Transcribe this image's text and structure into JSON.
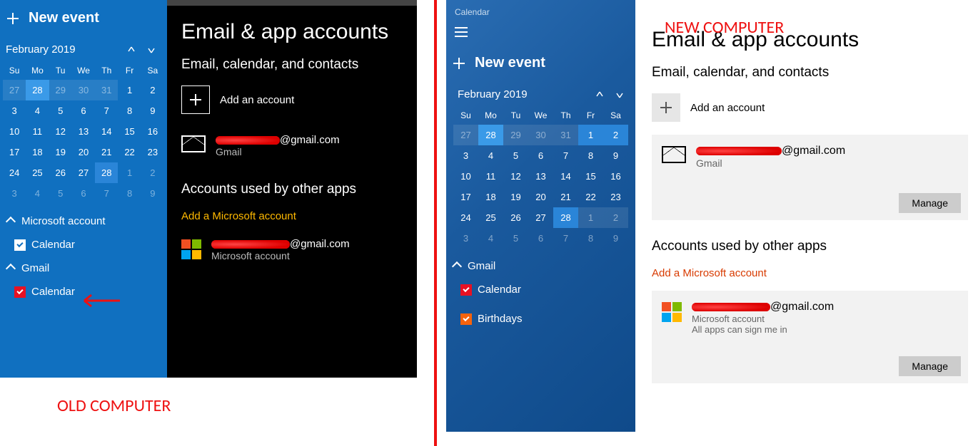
{
  "old": {
    "calendar": {
      "new_event": "New event",
      "month": "February 2019",
      "dow": [
        "Su",
        "Mo",
        "Tu",
        "We",
        "Th",
        "Fr",
        "Sa"
      ],
      "rows": [
        [
          {
            "d": "27",
            "dim": 1,
            "shade": 1
          },
          {
            "d": "28",
            "sel": 1
          },
          {
            "d": "29",
            "dim": 1,
            "shade": 1
          },
          {
            "d": "30",
            "dim": 1,
            "shade": 1
          },
          {
            "d": "31",
            "dim": 1,
            "shade": 1
          },
          {
            "d": "1"
          },
          {
            "d": "2"
          }
        ],
        [
          {
            "d": "3"
          },
          {
            "d": "4"
          },
          {
            "d": "5"
          },
          {
            "d": "6"
          },
          {
            "d": "7"
          },
          {
            "d": "8"
          },
          {
            "d": "9"
          }
        ],
        [
          {
            "d": "10"
          },
          {
            "d": "11"
          },
          {
            "d": "12"
          },
          {
            "d": "13"
          },
          {
            "d": "14"
          },
          {
            "d": "15"
          },
          {
            "d": "16"
          }
        ],
        [
          {
            "d": "17"
          },
          {
            "d": "18"
          },
          {
            "d": "19"
          },
          {
            "d": "20"
          },
          {
            "d": "21"
          },
          {
            "d": "22"
          },
          {
            "d": "23"
          }
        ],
        [
          {
            "d": "24"
          },
          {
            "d": "25"
          },
          {
            "d": "26"
          },
          {
            "d": "27"
          },
          {
            "d": "28",
            "bright": 1
          },
          {
            "d": "1",
            "dim": 1
          },
          {
            "d": "2",
            "dim": 1
          }
        ],
        [
          {
            "d": "3",
            "dim": 1
          },
          {
            "d": "4",
            "dim": 1
          },
          {
            "d": "5",
            "dim": 1
          },
          {
            "d": "6",
            "dim": 1
          },
          {
            "d": "7",
            "dim": 1
          },
          {
            "d": "8",
            "dim": 1
          },
          {
            "d": "9",
            "dim": 1
          }
        ]
      ],
      "acct1": "Microsoft account",
      "acct1_item": "Calendar",
      "acct2": "Gmail",
      "acct2_item": "Calendar"
    },
    "settings": {
      "h1": "Email & app accounts",
      "h2a": "Email, calendar, and contacts",
      "add": "Add an account",
      "email_suffix": "@gmail.com",
      "gmail": "Gmail",
      "h2b": "Accounts used by other apps",
      "addms": "Add a Microsoft account",
      "msacct": "Microsoft account"
    },
    "label": "OLD COMPUTER"
  },
  "new": {
    "calendar": {
      "title": "Calendar",
      "new_event": "New event",
      "month": "February 2019",
      "dow": [
        "Su",
        "Mo",
        "Tu",
        "We",
        "Th",
        "Fr",
        "Sa"
      ],
      "rows": [
        [
          {
            "d": "27",
            "dim": 1,
            "shade": 1
          },
          {
            "d": "28",
            "sel": 1
          },
          {
            "d": "29",
            "dim": 1,
            "shade": 1
          },
          {
            "d": "30",
            "dim": 1,
            "shade": 1
          },
          {
            "d": "31",
            "dim": 1,
            "shade": 1
          },
          {
            "d": "1",
            "bright": 1
          },
          {
            "d": "2",
            "bright": 1
          }
        ],
        [
          {
            "d": "3"
          },
          {
            "d": "4"
          },
          {
            "d": "5"
          },
          {
            "d": "6"
          },
          {
            "d": "7"
          },
          {
            "d": "8"
          },
          {
            "d": "9"
          }
        ],
        [
          {
            "d": "10"
          },
          {
            "d": "11"
          },
          {
            "d": "12"
          },
          {
            "d": "13"
          },
          {
            "d": "14"
          },
          {
            "d": "15"
          },
          {
            "d": "16"
          }
        ],
        [
          {
            "d": "17"
          },
          {
            "d": "18"
          },
          {
            "d": "19"
          },
          {
            "d": "20"
          },
          {
            "d": "21"
          },
          {
            "d": "22"
          },
          {
            "d": "23"
          }
        ],
        [
          {
            "d": "24"
          },
          {
            "d": "25"
          },
          {
            "d": "26"
          },
          {
            "d": "27"
          },
          {
            "d": "28",
            "bright": 1
          },
          {
            "d": "1",
            "dim": 1,
            "shade": 1
          },
          {
            "d": "2",
            "dim": 1,
            "shade": 1
          }
        ],
        [
          {
            "d": "3",
            "dim": 1
          },
          {
            "d": "4",
            "dim": 1
          },
          {
            "d": "5",
            "dim": 1
          },
          {
            "d": "6",
            "dim": 1
          },
          {
            "d": "7",
            "dim": 1
          },
          {
            "d": "8",
            "dim": 1
          },
          {
            "d": "9",
            "dim": 1
          }
        ]
      ],
      "acct1": "Gmail",
      "item1": "Calendar",
      "item2": "Birthdays"
    },
    "settings": {
      "h1": "Email & app accounts",
      "h2a": "Email, calendar, and contacts",
      "add": "Add an account",
      "email_suffix": "@gmail.com",
      "gmail": "Gmail",
      "manage": "Manage",
      "h2b": "Accounts used by other apps",
      "addms": "Add a Microsoft account",
      "msacct": "Microsoft account",
      "msnote": "All apps can sign me in"
    },
    "label": "NEW COMPUTER"
  }
}
